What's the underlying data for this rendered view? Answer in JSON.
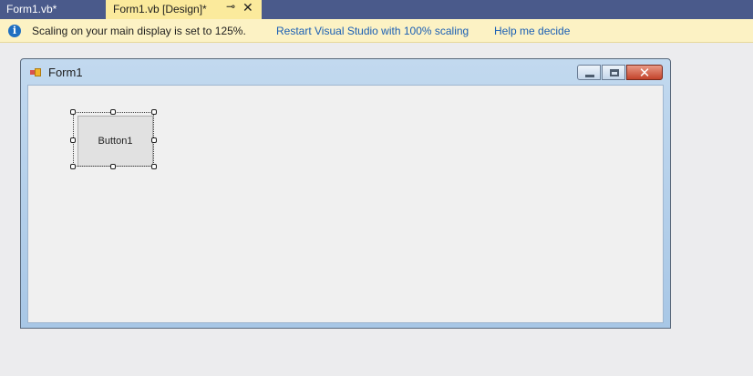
{
  "tabs": [
    {
      "label": "Form1.vb*",
      "active": false
    },
    {
      "label": "Form1.vb [Design]*",
      "active": true
    }
  ],
  "tab_pin_glyph": "⊸",
  "tab_close_glyph": "✕",
  "infobar": {
    "icon": "info-icon",
    "message": "Scaling on your main display is set to 125%.",
    "link_restart": "Restart Visual Studio with 100% scaling",
    "link_help": "Help me decide"
  },
  "form": {
    "title": "Form1",
    "button_label": "Button1"
  },
  "colors": {
    "tab_strip": "#4a5a8b",
    "active_tab": "#fbea9c",
    "infobar": "#fcf2c4",
    "link": "#1a5fb4",
    "close_button": "#c3432b"
  }
}
